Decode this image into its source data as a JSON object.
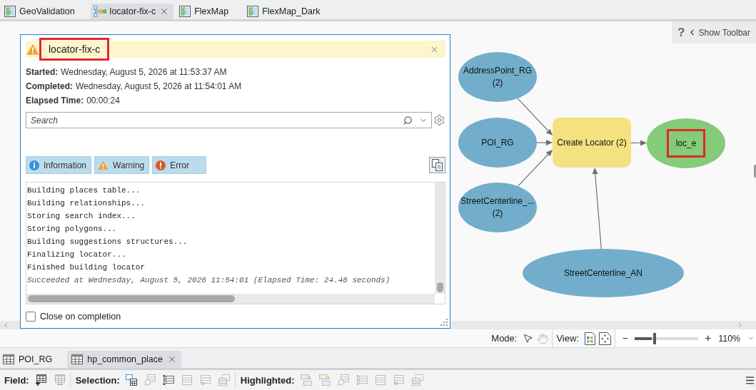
{
  "document_tabs": [
    {
      "label": "GeoValidation",
      "kind": "map",
      "selected": false
    },
    {
      "label": "locator-fix-c",
      "kind": "model",
      "selected": true
    },
    {
      "label": "FlexMap",
      "kind": "map",
      "selected": false
    },
    {
      "label": "FlexMap_Dark",
      "kind": "map",
      "selected": false
    }
  ],
  "toolbar_toggle": {
    "help": "?",
    "label": "Show Toolbar"
  },
  "model": {
    "inputs": [
      {
        "lines": [
          "AddressPoint_RG",
          "(2)"
        ],
        "highlighted": false
      },
      {
        "lines": [
          "POI_RG"
        ],
        "highlighted": false
      },
      {
        "lines": [
          "StreetCenterline_...",
          "(2)"
        ],
        "highlighted": false
      },
      {
        "lines": [
          "StreetCenterline_AN"
        ],
        "highlighted": false
      }
    ],
    "process": {
      "lines": [
        "Create Locator (2)"
      ],
      "highlighted": false
    },
    "outputs": [
      {
        "lines": [
          "loc_e"
        ],
        "highlighted": true
      }
    ]
  },
  "message_window": {
    "title": "locator-fix-c",
    "title_highlighted": true,
    "details": [
      {
        "label": "Started:",
        "value": "Wednesday, August 5, 2026 at 11:53:37 AM"
      },
      {
        "label": "Completed:",
        "value": "Wednesday, August 5, 2026 at 11:54:01 AM"
      },
      {
        "label": "Elapsed Time:",
        "value": "00:00:24"
      }
    ],
    "search": {
      "placeholder": "Search"
    },
    "filters": [
      {
        "kind": "information",
        "label": "Information",
        "selected": true
      },
      {
        "kind": "warning",
        "label": "Warning",
        "selected": true
      },
      {
        "kind": "error",
        "label": "Error",
        "selected": true
      }
    ],
    "log": [
      {
        "kind": "message",
        "text": "Building places table..."
      },
      {
        "kind": "message",
        "text": "Building relationships..."
      },
      {
        "kind": "message",
        "text": "Storing search index..."
      },
      {
        "kind": "message",
        "text": "Storing polygons..."
      },
      {
        "kind": "message",
        "text": "Building suggestions structures..."
      },
      {
        "kind": "message",
        "text": "Finalizing locator..."
      },
      {
        "kind": "message",
        "text": "Finished building locator"
      },
      {
        "kind": "success",
        "text": "Succeeded at Wednesday, August 5, 2026 11:54:01 (Elapsed Time: 24.46 seconds)"
      }
    ],
    "close_on_completion": {
      "label": "Close on completion",
      "checked": false
    }
  },
  "status_bar": {
    "mode": {
      "label": "Mode:",
      "tools": [
        {
          "kind": "pointer",
          "selected": true
        },
        {
          "kind": "pan",
          "selected": false
        }
      ]
    },
    "view": {
      "label": "View:",
      "tools": [
        {
          "kind": "auto-layout"
        },
        {
          "kind": "full-extent"
        }
      ]
    },
    "zoom": {
      "level": 0.27,
      "reading": "110%"
    }
  },
  "table_tabs": [
    {
      "label": "POI_RG",
      "selected": false
    },
    {
      "label": "hp_common_place",
      "selected": true
    }
  ],
  "table_toolbar": [
    {
      "label": "Field:",
      "tools": [
        {
          "kind": "table-plus",
          "disabled": false
        },
        {
          "kind": "table-minus",
          "disabled": true
        }
      ]
    },
    {
      "label": "Selection:",
      "tools": [
        {
          "kind": "table-cursor",
          "disabled": false
        },
        {
          "kind": "zoom",
          "disabled": true
        },
        {
          "kind": "switch",
          "disabled": false
        },
        {
          "kind": "rows",
          "disabled": true
        },
        {
          "kind": "delete",
          "disabled": true
        },
        {
          "kind": "copy",
          "disabled": true
        }
      ]
    },
    {
      "label": "Highlighted:",
      "tools": [
        {
          "kind": "rows-arrow",
          "disabled": true
        },
        {
          "kind": "rows-arrow",
          "disabled": true
        },
        {
          "kind": "zoom",
          "disabled": true
        },
        {
          "kind": "switch",
          "disabled": true
        },
        {
          "kind": "rows",
          "disabled": true
        },
        {
          "kind": "delete",
          "disabled": true
        },
        {
          "kind": "copy",
          "disabled": true
        }
      ]
    }
  ]
}
